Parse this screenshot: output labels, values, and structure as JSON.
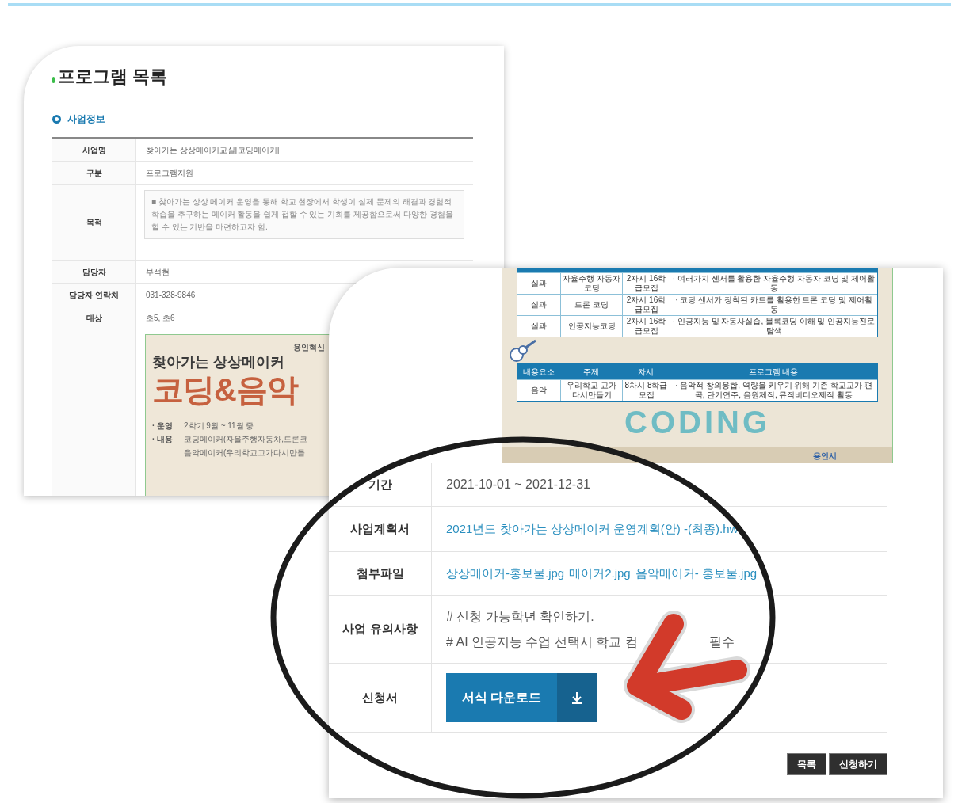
{
  "detail_page": {
    "title": "프로그램 목록",
    "section": "사업정보",
    "rows": [
      {
        "label": "사업명",
        "kind": "text",
        "value": "찾아가는 상상메이커교실[코딩메이커]"
      },
      {
        "label": "구분",
        "kind": "text",
        "value": "프로그램지원"
      },
      {
        "label": "목적",
        "kind": "box",
        "value": "■ 찾아가는 상상 메이커 운영을 통해 학교 현장에서 학생이 실제 문제의 해결과 경험적 학습을 추구하는 메이커 활동을 쉽게 접할 수 있는 기회를 제공함으로써 다양한 경험을 할 수 있는 기반을 마련하고자 함."
      },
      {
        "label": "담당자",
        "kind": "text",
        "value": "부석현"
      },
      {
        "label": "담당자 연락처",
        "kind": "text",
        "value": "031-328-9846"
      },
      {
        "label": "대상",
        "kind": "text",
        "value": "초5, 초6"
      }
    ],
    "poster": {
      "org": "용인혁신",
      "subtitle": "찾아가는 상상메이커",
      "headline": "코딩&음악",
      "lines": [
        {
          "label": "· 운영",
          "text": "2학기 9월 ~ 11월 중"
        },
        {
          "label": "· 내용",
          "text": "코딩메이커(자율주행자동차,드론코"
        },
        {
          "text": "음악메이커(우리학교고가다시만들"
        }
      ]
    }
  },
  "zoomed_page": {
    "poster": {
      "table_1_rows": [
        [
          "실과",
          "자율주행 자동차코딩",
          "2차시 16학급모집",
          "· 여러가지 센서를 활용한 자율주행 자동차 코딩 및 제어활동"
        ],
        [
          "실과",
          "드론 코딩",
          "2차시 16학급모집",
          "· 코딩 센서가 장착된 카드를 활용한 드론 코딩 및 제어활동"
        ],
        [
          "실과",
          "인공지능코딩",
          "2차시 16학급모집",
          "· 인공지능 및 자동사실습, 블록코딩 이해 및 인공지능진로탐색"
        ]
      ],
      "table_2_columns": [
        "내용요소",
        "주제",
        "차시",
        "프로그램 내용"
      ],
      "table_2_rows": [
        [
          "음악",
          "우리학교 교가 다시만들기",
          "8차시 8학급모집",
          "· 음악적 창의융합, 역량을 키우기 위해 기존 학교교가 편곡, 단기연주, 음원제작, 뮤직비디오제작 활동"
        ]
      ],
      "art_text": "CODING",
      "footer_logo": "용인시"
    },
    "rows": [
      {
        "label": "기간",
        "kind": "text",
        "lines": [
          [
            "2021-10-01 ~ 2021-12-31"
          ]
        ]
      },
      {
        "label": "사업계획서",
        "kind": "links",
        "links": [
          "2021년도 찾아가는 상상메이커 운영계획(안) -(최종).hw"
        ]
      },
      {
        "label": "첨부파일",
        "kind": "links",
        "links": [
          "상상메이커-홍보물.jpg",
          "메이커2.jpg",
          "음악메이커- 홍보물.jpg"
        ]
      },
      {
        "label": "사업 유의사항",
        "kind": "text",
        "lines": [
          [
            "# 신청 가능학년 확인하기."
          ],
          [
            "# AI 인공지능 수업 선택시 학교 컴",
            "필수"
          ]
        ]
      },
      {
        "label": "신청서",
        "kind": "button",
        "button": "서식 다운로드"
      }
    ],
    "buttons": [
      "목록",
      "신청하기"
    ]
  }
}
